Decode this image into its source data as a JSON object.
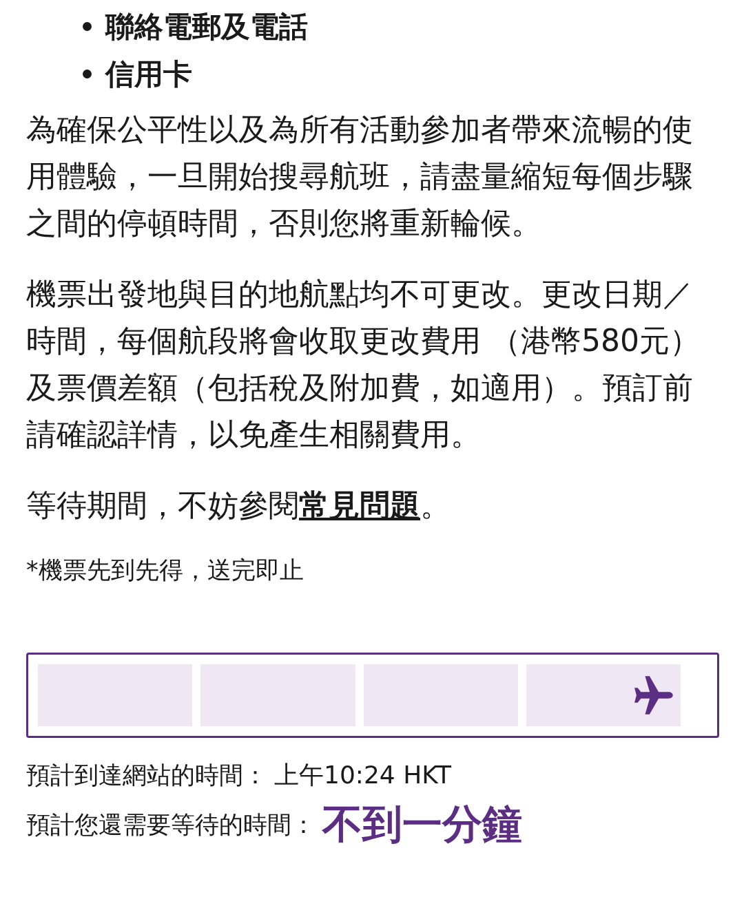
{
  "requirements": [
    "聯絡電郵及電話",
    "信用卡"
  ],
  "paragraphs": [
    "為確保公平性以及為所有活動參加者帶來流暢的使用體驗，一旦開始搜尋航班，請盡量縮短每個步驟之間的停頓時間，否則您將重新輪候。",
    "機票出發地與目的地航點均不可更改。更改日期／時間，每個航段將會收取更改費用 （港幣580元）及票價差額（包括稅及附加費，如適用）。預訂前請確認詳情，以免產生相關費用。"
  ],
  "faq_note": {
    "before": "等待期間，不妨參閱",
    "link": "常見問題",
    "after": "。"
  },
  "footnote": "*機票先到先得，送完即止",
  "arrival": {
    "label": "預計到達網站的時間：",
    "value": "上午10:24 HKT"
  },
  "wait": {
    "label": "預計您還需要等待的時間：",
    "value": "不到一分鐘"
  }
}
